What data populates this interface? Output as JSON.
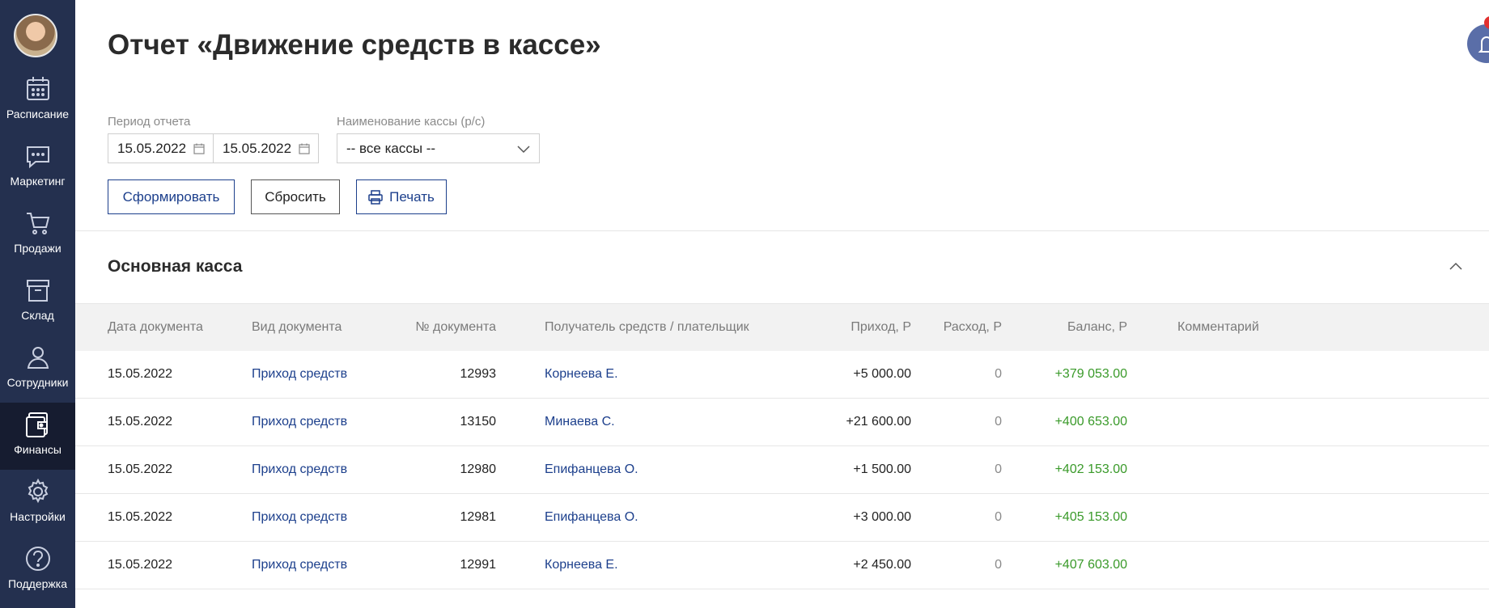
{
  "sidebar": {
    "items": [
      {
        "label": "Расписание",
        "icon": "calendar-icon"
      },
      {
        "label": "Маркетинг",
        "icon": "chat-icon"
      },
      {
        "label": "Продажи",
        "icon": "cart-icon"
      },
      {
        "label": "Склад",
        "icon": "archive-box-icon"
      },
      {
        "label": "Сотрудники",
        "icon": "person-icon"
      },
      {
        "label": "Финансы",
        "icon": "wallet-icon"
      },
      {
        "label": "Настройки",
        "icon": "gear-icon"
      },
      {
        "label": "Поддержка",
        "icon": "question-icon"
      }
    ],
    "active_color": "#161c30",
    "bg_color": "#24304f"
  },
  "header": {
    "title": "Отчет «Движение средств в кассе»"
  },
  "filters": {
    "period_label": "Период отчета",
    "date_from": "15.05.2022",
    "date_to": "15.05.2022",
    "cash_label": "Наименование кассы (р/с)",
    "cash_value": "-- все кассы --"
  },
  "buttons": {
    "generate": "Сформировать",
    "reset": "Сбросить",
    "print": "Печать"
  },
  "section": {
    "title": "Основная касса"
  },
  "table": {
    "headers": {
      "date": "Дата документа",
      "type": "Вид документа",
      "number": "№ документа",
      "payer": "Получатель средств / плательщик",
      "income": "Приход, Р",
      "expense": "Расход, Р",
      "balance": "Баланс, Р",
      "comment": "Комментарий"
    },
    "rows": [
      {
        "date": "15.05.2022",
        "type": "Приход средств",
        "number": "12993",
        "payer": "Корнеева Е.",
        "income": "+5 000.00",
        "expense": "0",
        "balance": "+379 053.00",
        "comment": ""
      },
      {
        "date": "15.05.2022",
        "type": "Приход средств",
        "number": "13150",
        "payer": "Минаева С.",
        "income": "+21 600.00",
        "expense": "0",
        "balance": "+400 653.00",
        "comment": ""
      },
      {
        "date": "15.05.2022",
        "type": "Приход средств",
        "number": "12980",
        "payer": "Епифанцева О.",
        "income": "+1 500.00",
        "expense": "0",
        "balance": "+402 153.00",
        "comment": ""
      },
      {
        "date": "15.05.2022",
        "type": "Приход средств",
        "number": "12981",
        "payer": "Епифанцева О.",
        "income": "+3 000.00",
        "expense": "0",
        "balance": "+405 153.00",
        "comment": ""
      },
      {
        "date": "15.05.2022",
        "type": "Приход средств",
        "number": "12991",
        "payer": "Корнеева Е.",
        "income": "+2 450.00",
        "expense": "0",
        "balance": "+407 603.00",
        "comment": ""
      }
    ]
  },
  "colors": {
    "accent": "#1c3f8c",
    "positive": "#3a9a2a",
    "notification": "#e2302f"
  }
}
